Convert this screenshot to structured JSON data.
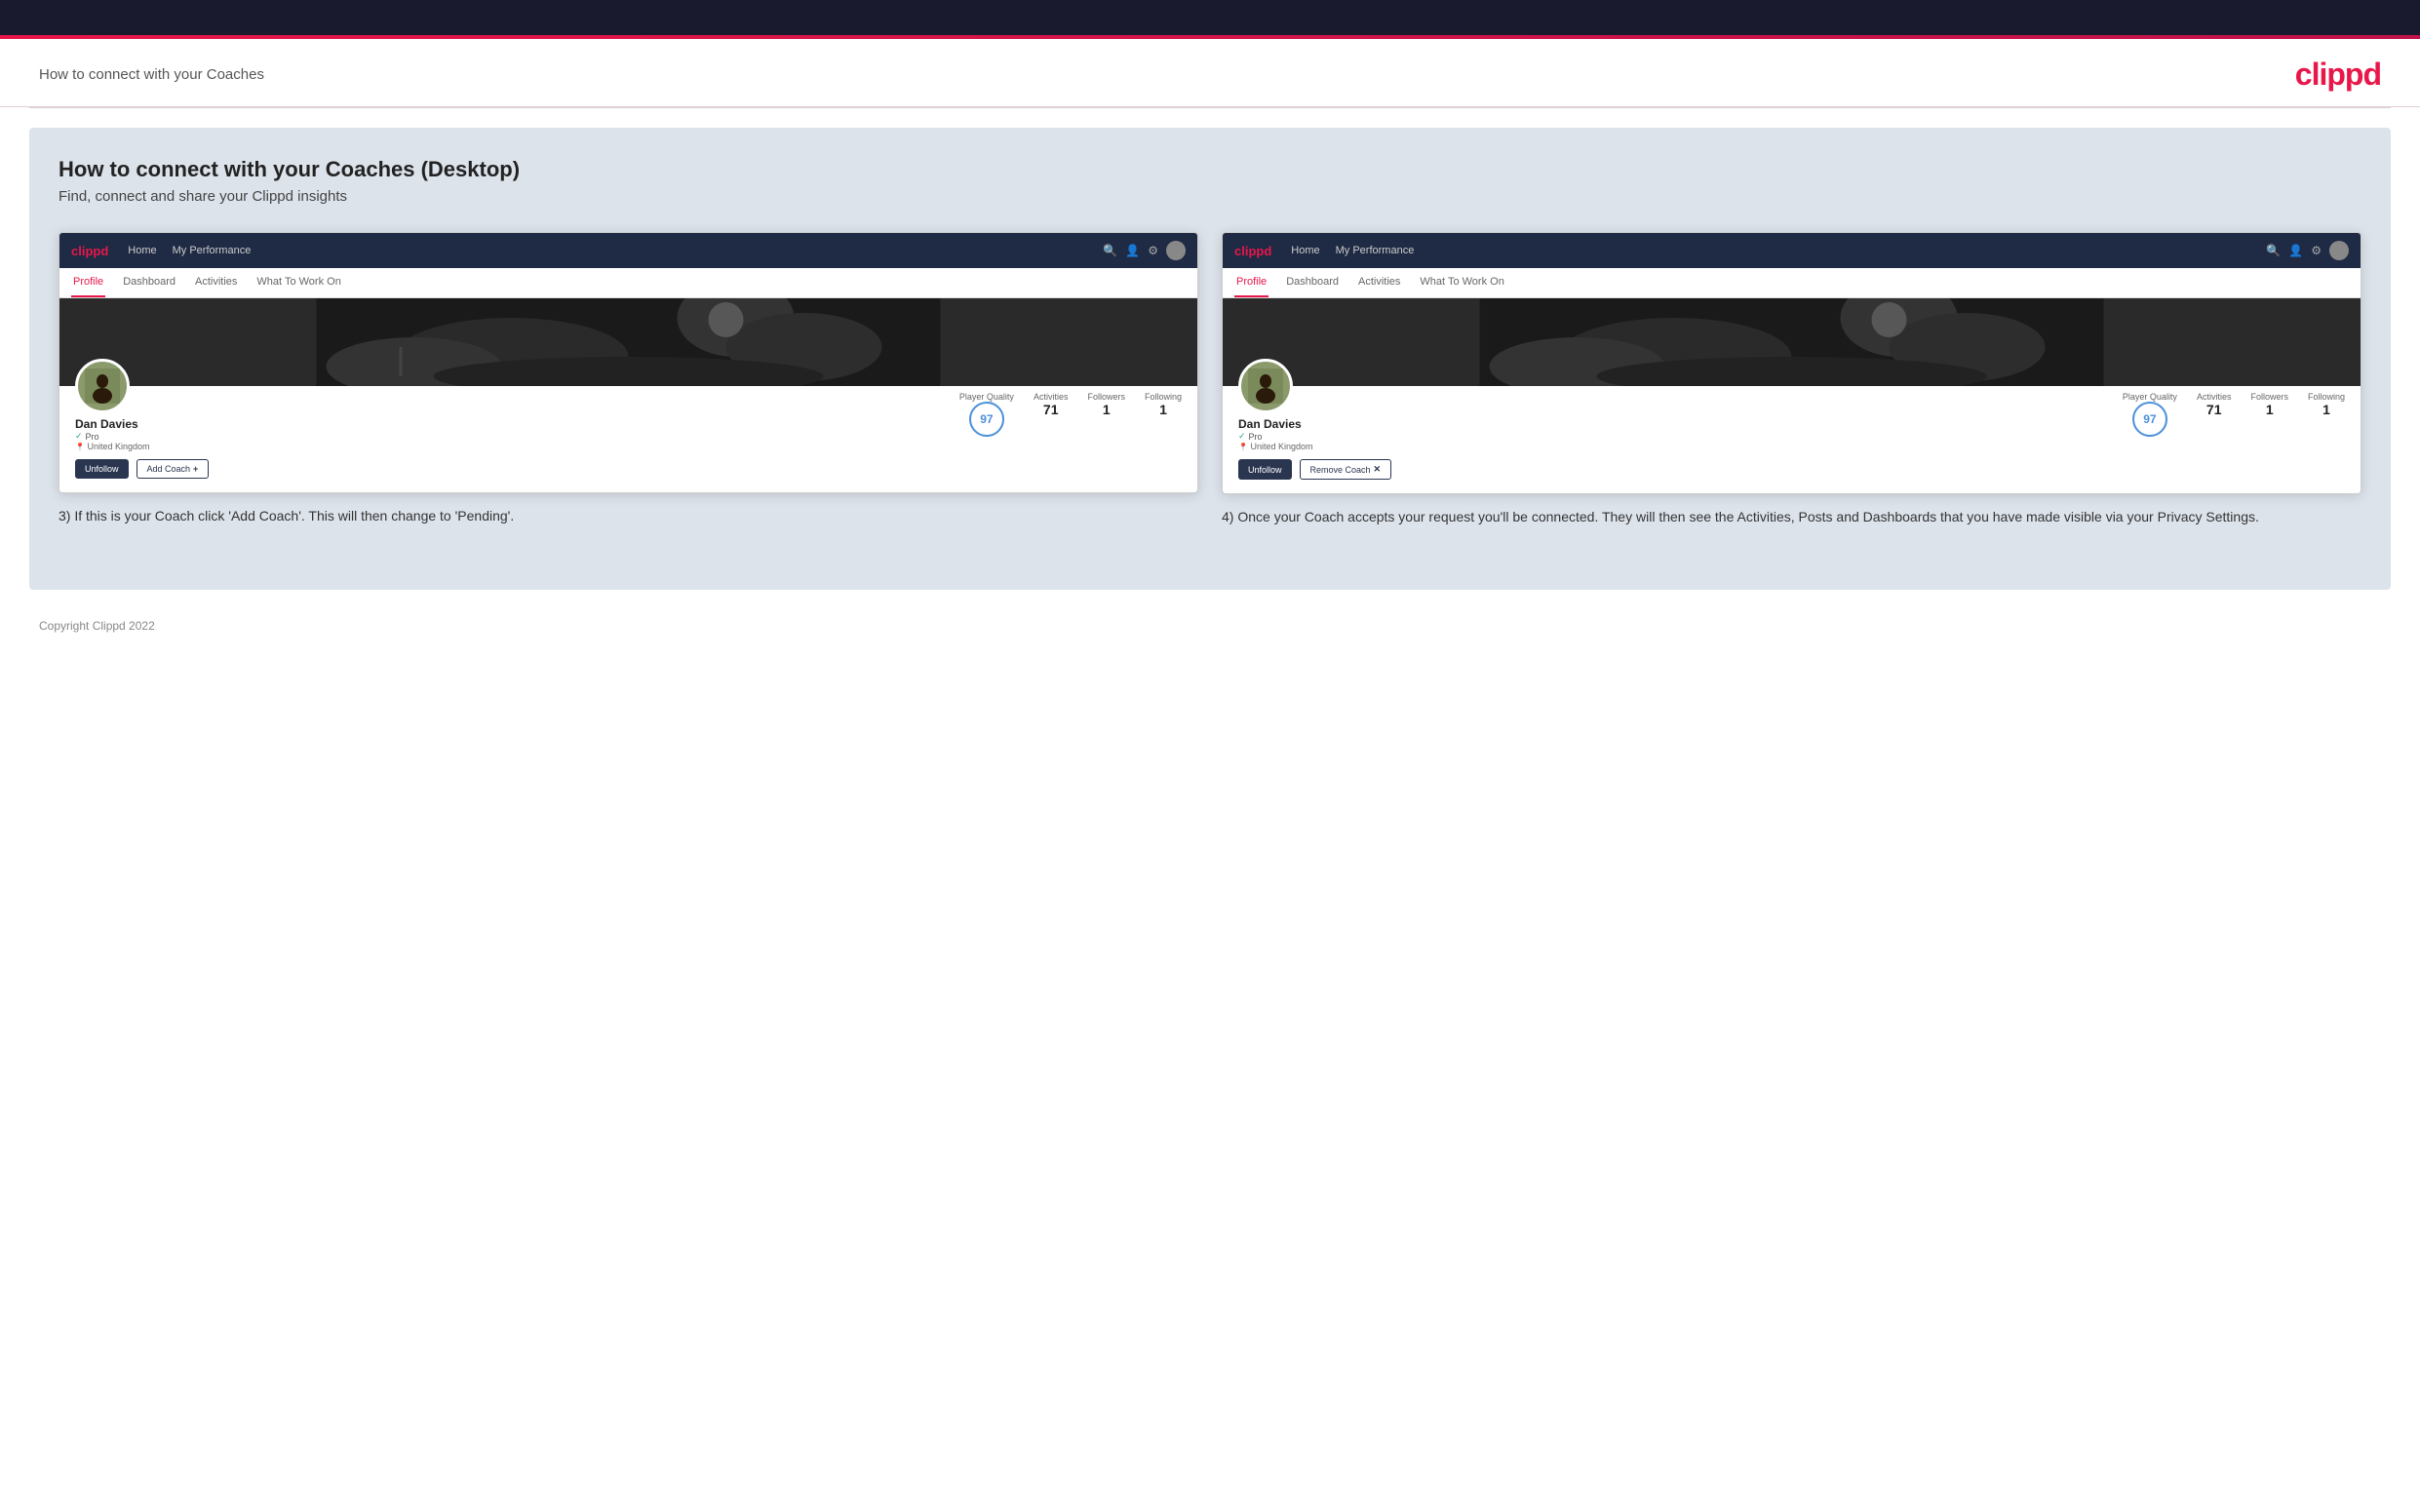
{
  "topBar": {},
  "accentBar": {},
  "header": {
    "title": "How to connect with your Coaches",
    "logo": "clippd"
  },
  "main": {
    "heading": "How to connect with your Coaches (Desktop)",
    "subheading": "Find, connect and share your Clippd insights",
    "leftScreenshot": {
      "nav": {
        "logo": "clippd",
        "items": [
          "Home",
          "My Performance"
        ],
        "icons": [
          "search",
          "user",
          "settings",
          "avatar"
        ]
      },
      "tabs": [
        "Profile",
        "Dashboard",
        "Activities",
        "What To Work On"
      ],
      "activeTab": "Profile",
      "user": {
        "name": "Dan Davies",
        "badge": "Pro",
        "location": "United Kingdom",
        "playerQuality": 97,
        "activities": 71,
        "followers": 1,
        "following": 1
      },
      "buttons": [
        "Unfollow",
        "Add Coach"
      ]
    },
    "rightScreenshot": {
      "nav": {
        "logo": "clippd",
        "items": [
          "Home",
          "My Performance"
        ],
        "icons": [
          "search",
          "user",
          "settings",
          "avatar"
        ]
      },
      "tabs": [
        "Profile",
        "Dashboard",
        "Activities",
        "What To Work On"
      ],
      "activeTab": "Profile",
      "user": {
        "name": "Dan Davies",
        "badge": "Pro",
        "location": "United Kingdom",
        "playerQuality": 97,
        "activities": 71,
        "followers": 1,
        "following": 1
      },
      "buttons": [
        "Unfollow",
        "Remove Coach"
      ]
    },
    "leftCaption": "3) If this is your Coach click 'Add Coach'. This will then change to 'Pending'.",
    "rightCaption": "4) Once your Coach accepts your request you'll be connected. They will then see the Activities, Posts and Dashboards that you have made visible via your Privacy Settings."
  },
  "footer": {
    "copyright": "Copyright Clippd 2022"
  },
  "labels": {
    "playerQuality": "Player Quality",
    "activities": "Activities",
    "followers": "Followers",
    "following": "Following",
    "pro": "Pro",
    "unitedKingdom": "United Kingdom",
    "unfollow": "Unfollow",
    "addCoach": "Add Coach",
    "removeCoach": "Remove Coach",
    "home": "Home",
    "myPerformance": "My Performance",
    "profile": "Profile",
    "dashboard": "Dashboard",
    "activitiesTab": "Activities",
    "whatToWorkOn": "What To Work On"
  }
}
